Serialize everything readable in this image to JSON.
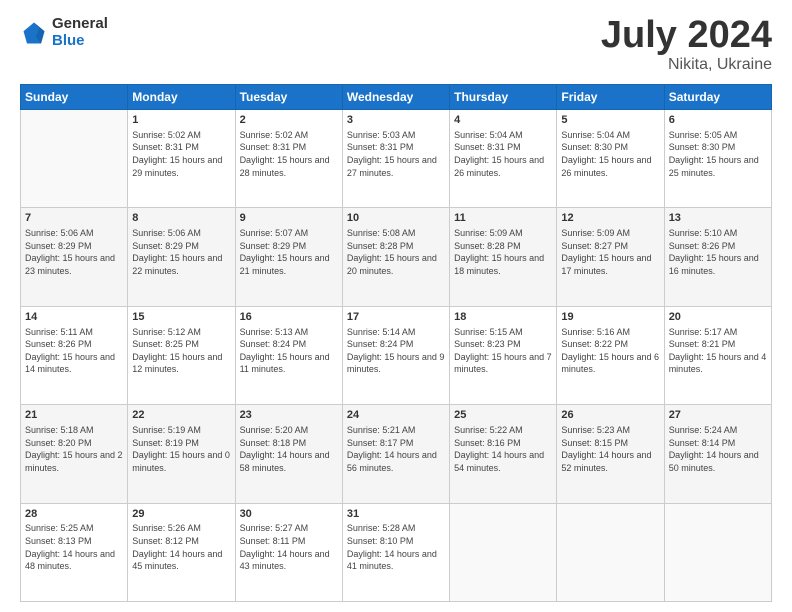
{
  "header": {
    "logo_general": "General",
    "logo_blue": "Blue",
    "title": "July 2024",
    "location": "Nikita, Ukraine"
  },
  "days_header": [
    "Sunday",
    "Monday",
    "Tuesday",
    "Wednesday",
    "Thursday",
    "Friday",
    "Saturday"
  ],
  "weeks": [
    {
      "shade": false,
      "days": [
        {
          "number": "",
          "sunrise": "",
          "sunset": "",
          "daylight": "",
          "empty": true
        },
        {
          "number": "1",
          "sunrise": "Sunrise: 5:02 AM",
          "sunset": "Sunset: 8:31 PM",
          "daylight": "Daylight: 15 hours and 29 minutes.",
          "empty": false
        },
        {
          "number": "2",
          "sunrise": "Sunrise: 5:02 AM",
          "sunset": "Sunset: 8:31 PM",
          "daylight": "Daylight: 15 hours and 28 minutes.",
          "empty": false
        },
        {
          "number": "3",
          "sunrise": "Sunrise: 5:03 AM",
          "sunset": "Sunset: 8:31 PM",
          "daylight": "Daylight: 15 hours and 27 minutes.",
          "empty": false
        },
        {
          "number": "4",
          "sunrise": "Sunrise: 5:04 AM",
          "sunset": "Sunset: 8:31 PM",
          "daylight": "Daylight: 15 hours and 26 minutes.",
          "empty": false
        },
        {
          "number": "5",
          "sunrise": "Sunrise: 5:04 AM",
          "sunset": "Sunset: 8:30 PM",
          "daylight": "Daylight: 15 hours and 26 minutes.",
          "empty": false
        },
        {
          "number": "6",
          "sunrise": "Sunrise: 5:05 AM",
          "sunset": "Sunset: 8:30 PM",
          "daylight": "Daylight: 15 hours and 25 minutes.",
          "empty": false
        }
      ]
    },
    {
      "shade": true,
      "days": [
        {
          "number": "7",
          "sunrise": "Sunrise: 5:06 AM",
          "sunset": "Sunset: 8:29 PM",
          "daylight": "Daylight: 15 hours and 23 minutes.",
          "empty": false
        },
        {
          "number": "8",
          "sunrise": "Sunrise: 5:06 AM",
          "sunset": "Sunset: 8:29 PM",
          "daylight": "Daylight: 15 hours and 22 minutes.",
          "empty": false
        },
        {
          "number": "9",
          "sunrise": "Sunrise: 5:07 AM",
          "sunset": "Sunset: 8:29 PM",
          "daylight": "Daylight: 15 hours and 21 minutes.",
          "empty": false
        },
        {
          "number": "10",
          "sunrise": "Sunrise: 5:08 AM",
          "sunset": "Sunset: 8:28 PM",
          "daylight": "Daylight: 15 hours and 20 minutes.",
          "empty": false
        },
        {
          "number": "11",
          "sunrise": "Sunrise: 5:09 AM",
          "sunset": "Sunset: 8:28 PM",
          "daylight": "Daylight: 15 hours and 18 minutes.",
          "empty": false
        },
        {
          "number": "12",
          "sunrise": "Sunrise: 5:09 AM",
          "sunset": "Sunset: 8:27 PM",
          "daylight": "Daylight: 15 hours and 17 minutes.",
          "empty": false
        },
        {
          "number": "13",
          "sunrise": "Sunrise: 5:10 AM",
          "sunset": "Sunset: 8:26 PM",
          "daylight": "Daylight: 15 hours and 16 minutes.",
          "empty": false
        }
      ]
    },
    {
      "shade": false,
      "days": [
        {
          "number": "14",
          "sunrise": "Sunrise: 5:11 AM",
          "sunset": "Sunset: 8:26 PM",
          "daylight": "Daylight: 15 hours and 14 minutes.",
          "empty": false
        },
        {
          "number": "15",
          "sunrise": "Sunrise: 5:12 AM",
          "sunset": "Sunset: 8:25 PM",
          "daylight": "Daylight: 15 hours and 12 minutes.",
          "empty": false
        },
        {
          "number": "16",
          "sunrise": "Sunrise: 5:13 AM",
          "sunset": "Sunset: 8:24 PM",
          "daylight": "Daylight: 15 hours and 11 minutes.",
          "empty": false
        },
        {
          "number": "17",
          "sunrise": "Sunrise: 5:14 AM",
          "sunset": "Sunset: 8:24 PM",
          "daylight": "Daylight: 15 hours and 9 minutes.",
          "empty": false
        },
        {
          "number": "18",
          "sunrise": "Sunrise: 5:15 AM",
          "sunset": "Sunset: 8:23 PM",
          "daylight": "Daylight: 15 hours and 7 minutes.",
          "empty": false
        },
        {
          "number": "19",
          "sunrise": "Sunrise: 5:16 AM",
          "sunset": "Sunset: 8:22 PM",
          "daylight": "Daylight: 15 hours and 6 minutes.",
          "empty": false
        },
        {
          "number": "20",
          "sunrise": "Sunrise: 5:17 AM",
          "sunset": "Sunset: 8:21 PM",
          "daylight": "Daylight: 15 hours and 4 minutes.",
          "empty": false
        }
      ]
    },
    {
      "shade": true,
      "days": [
        {
          "number": "21",
          "sunrise": "Sunrise: 5:18 AM",
          "sunset": "Sunset: 8:20 PM",
          "daylight": "Daylight: 15 hours and 2 minutes.",
          "empty": false
        },
        {
          "number": "22",
          "sunrise": "Sunrise: 5:19 AM",
          "sunset": "Sunset: 8:19 PM",
          "daylight": "Daylight: 15 hours and 0 minutes.",
          "empty": false
        },
        {
          "number": "23",
          "sunrise": "Sunrise: 5:20 AM",
          "sunset": "Sunset: 8:18 PM",
          "daylight": "Daylight: 14 hours and 58 minutes.",
          "empty": false
        },
        {
          "number": "24",
          "sunrise": "Sunrise: 5:21 AM",
          "sunset": "Sunset: 8:17 PM",
          "daylight": "Daylight: 14 hours and 56 minutes.",
          "empty": false
        },
        {
          "number": "25",
          "sunrise": "Sunrise: 5:22 AM",
          "sunset": "Sunset: 8:16 PM",
          "daylight": "Daylight: 14 hours and 54 minutes.",
          "empty": false
        },
        {
          "number": "26",
          "sunrise": "Sunrise: 5:23 AM",
          "sunset": "Sunset: 8:15 PM",
          "daylight": "Daylight: 14 hours and 52 minutes.",
          "empty": false
        },
        {
          "number": "27",
          "sunrise": "Sunrise: 5:24 AM",
          "sunset": "Sunset: 8:14 PM",
          "daylight": "Daylight: 14 hours and 50 minutes.",
          "empty": false
        }
      ]
    },
    {
      "shade": false,
      "days": [
        {
          "number": "28",
          "sunrise": "Sunrise: 5:25 AM",
          "sunset": "Sunset: 8:13 PM",
          "daylight": "Daylight: 14 hours and 48 minutes.",
          "empty": false
        },
        {
          "number": "29",
          "sunrise": "Sunrise: 5:26 AM",
          "sunset": "Sunset: 8:12 PM",
          "daylight": "Daylight: 14 hours and 45 minutes.",
          "empty": false
        },
        {
          "number": "30",
          "sunrise": "Sunrise: 5:27 AM",
          "sunset": "Sunset: 8:11 PM",
          "daylight": "Daylight: 14 hours and 43 minutes.",
          "empty": false
        },
        {
          "number": "31",
          "sunrise": "Sunrise: 5:28 AM",
          "sunset": "Sunset: 8:10 PM",
          "daylight": "Daylight: 14 hours and 41 minutes.",
          "empty": false
        },
        {
          "number": "",
          "sunrise": "",
          "sunset": "",
          "daylight": "",
          "empty": true
        },
        {
          "number": "",
          "sunrise": "",
          "sunset": "",
          "daylight": "",
          "empty": true
        },
        {
          "number": "",
          "sunrise": "",
          "sunset": "",
          "daylight": "",
          "empty": true
        }
      ]
    }
  ]
}
